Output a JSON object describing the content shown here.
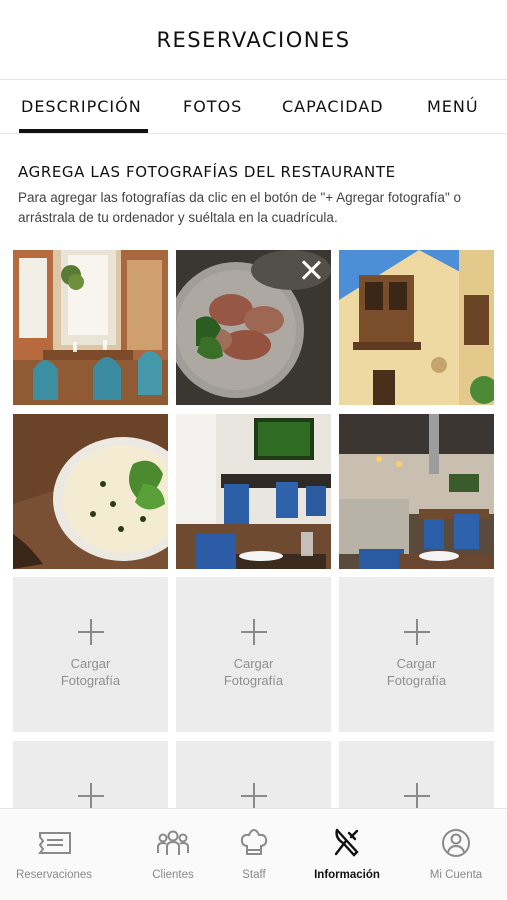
{
  "header": {
    "title": "RESERVACIONES"
  },
  "tabs": [
    {
      "label": "DESCRIPCIÓN",
      "active": true
    },
    {
      "label": "FOTOS"
    },
    {
      "label": "CAPACIDAD"
    },
    {
      "label": "MENÚ"
    }
  ],
  "section": {
    "title": "AGREGA LAS FOTOGRAFÍAS DEL RESTAURANTE",
    "description": "Para agregar las fotografías da clic en el botón de \"+ Agregar fotografía\" o arrástrala de tu ordenador y suéltala en la cuadrícula."
  },
  "upload": {
    "label_line1": "Cargar",
    "label_line2": "Fotografía"
  },
  "photos": [
    {
      "icon": "restaurant-interior-photo"
    },
    {
      "icon": "carpaccio-dish-photo",
      "removable": true
    },
    {
      "icon": "colonial-building-photo"
    },
    {
      "icon": "ceviche-dish-photo"
    },
    {
      "icon": "dining-room-photo"
    },
    {
      "icon": "bar-interior-photo"
    }
  ],
  "bottom_nav": [
    {
      "label": "Reservaciones",
      "icon": "ticket-icon"
    },
    {
      "label": "Clientes",
      "icon": "people-icon"
    },
    {
      "label": "Staff",
      "icon": "chef-hat-icon"
    },
    {
      "label": "Información",
      "icon": "fork-knife-icon",
      "active": true
    },
    {
      "label": "Mi Cuenta",
      "icon": "account-icon"
    }
  ],
  "colors": {
    "accent": "#111111",
    "upload_bg": "#ececec",
    "muted_text": "#8a8a8a"
  }
}
